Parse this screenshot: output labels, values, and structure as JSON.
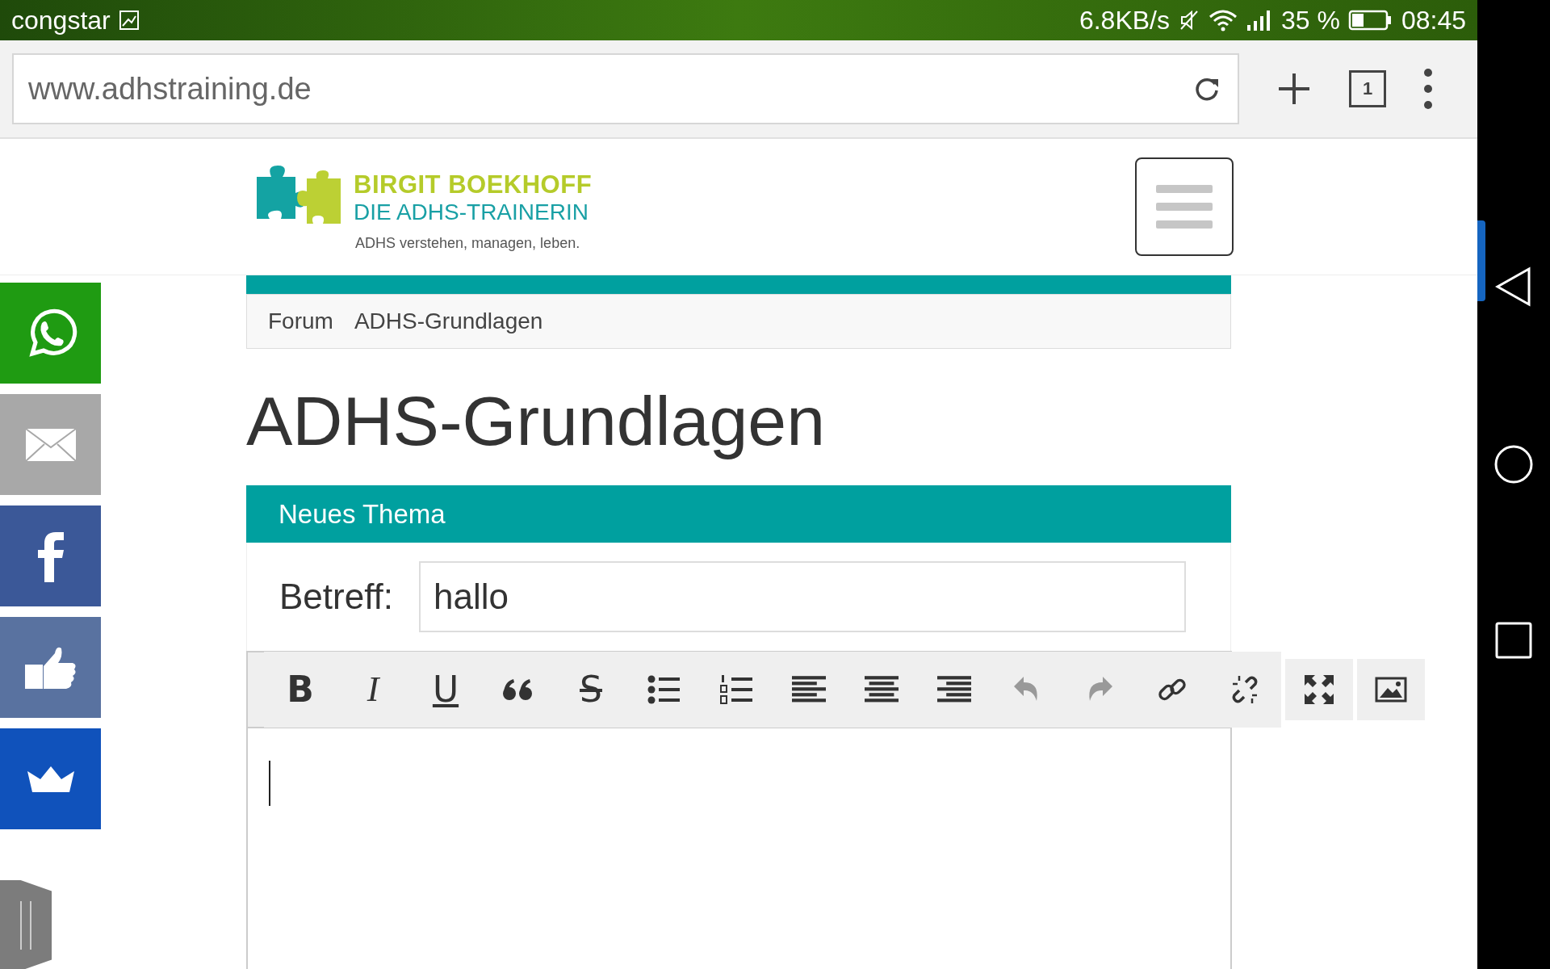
{
  "status_bar": {
    "carrier": "congstar",
    "speed": "6.8KB/s",
    "battery": "35 %",
    "time": "08:45"
  },
  "browser": {
    "url": "www.adhstraining.de",
    "tab_count": "1"
  },
  "logo": {
    "name": "BIRGIT BOEKHOFF",
    "subtitle": "DIE ADHS-TRAINERIN",
    "tagline": "ADHS verstehen, managen, leben."
  },
  "share_buttons": [
    {
      "kind": "whatsapp",
      "color": "#1f9b12"
    },
    {
      "kind": "email",
      "color": "#a8a8a8"
    },
    {
      "kind": "facebook",
      "color": "#3b5898"
    },
    {
      "kind": "like",
      "color": "#5972a0"
    },
    {
      "kind": "crown",
      "color": "#1052bb"
    }
  ],
  "breadcrumb": [
    "Forum",
    "ADHS-Grundlagen"
  ],
  "page_title": "ADHS-Grundlagen",
  "form": {
    "header": "Neues Thema",
    "subject_label": "Betreff:",
    "subject_value": "hallo"
  },
  "toolbar": [
    {
      "kind": "bold",
      "label": "B",
      "disabled": false
    },
    {
      "kind": "italic",
      "label": "I",
      "disabled": false
    },
    {
      "kind": "underline",
      "label": "U",
      "disabled": false
    },
    {
      "kind": "quote",
      "disabled": false
    },
    {
      "kind": "strike",
      "label": "S",
      "disabled": false
    },
    {
      "kind": "bullets",
      "disabled": false
    },
    {
      "kind": "numbers",
      "disabled": false
    },
    {
      "kind": "align-left",
      "disabled": false
    },
    {
      "kind": "align-center",
      "disabled": false
    },
    {
      "kind": "align-right",
      "disabled": false
    },
    {
      "kind": "undo",
      "disabled": true
    },
    {
      "kind": "redo",
      "disabled": true
    },
    {
      "kind": "link",
      "disabled": false
    },
    {
      "kind": "unlink",
      "disabled": false
    },
    {
      "kind": "fullscreen",
      "disabled": false
    },
    {
      "kind": "image",
      "disabled": false
    }
  ]
}
